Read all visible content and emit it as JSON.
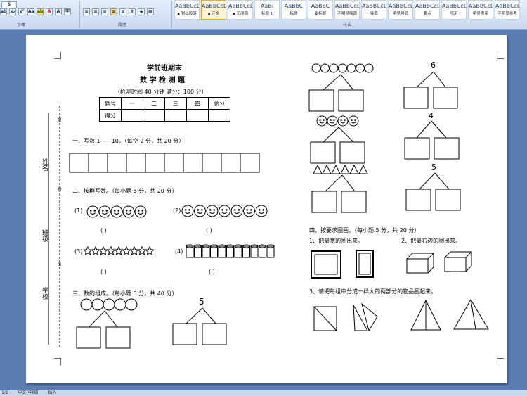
{
  "ribbon": {
    "font_size_value": "5",
    "group_font": "字体",
    "group_paragraph": "段落",
    "group_styles": "样式",
    "styles": [
      {
        "preview": "AaBbCcDd",
        "name": "▪ 列出段落"
      },
      {
        "preview": "AaBbCcDd",
        "name": "▪ 正文"
      },
      {
        "preview": "AaBbCcDd",
        "name": "▪ 无间隔"
      },
      {
        "preview": "AaBl",
        "name": "标题 1"
      },
      {
        "preview": "AaBbC",
        "name": "标题"
      },
      {
        "preview": "AaBbC",
        "name": "副标题"
      },
      {
        "preview": "AaBbCcDd",
        "name": "不明显强调"
      },
      {
        "preview": "AaBbCcDd",
        "name": "强调"
      },
      {
        "preview": "AaBbCcDd",
        "name": "明显强调"
      },
      {
        "preview": "AaBbCcDd",
        "name": "要点"
      },
      {
        "preview": "AaBbCcDd",
        "name": "引用"
      },
      {
        "preview": "AaBbCcDd",
        "name": "明显引用"
      },
      {
        "preview": "AaBbCcDd",
        "name": "不明显参考"
      }
    ]
  },
  "doc": {
    "title1": "学前班期末",
    "title2": "数 学 检 测 题",
    "info": "（检测时间 40 分钟     满分：100 分）",
    "score_header": [
      "题号",
      "一",
      "二",
      "三",
      "四",
      "总分"
    ],
    "score_row_label": "得分",
    "margin_name": "姓名",
    "margin_class": "班级",
    "margin_school": "学校",
    "margin_seal1": "線",
    "margin_seal2": "封",
    "margin_seal3": "密",
    "q1": "一、写数 1——10。（每空 2 分，共 20 分）",
    "q2": "二、按群写数。（每小题 5 分，共 20 分）",
    "q2_items": [
      "(1)",
      "(2)",
      "(3)",
      "(4)"
    ],
    "paren": "(          )",
    "q3": "三、数的组成。（每小题 5 分，共 40 分）",
    "q3_number_5": "5",
    "right_number_6": "6",
    "right_number_4": "4",
    "right_number_5": "5",
    "q4": "四、按要求圈画。（每小题 5 分，共 20 分）",
    "q4_1": "1、把最宽的圈出来。",
    "q4_2": "2、把最右边的圈出来。",
    "q4_3": "3、请把每组中分成一样大的两部分的物品圈起来。"
  },
  "status": {
    "page": "1/1",
    "language": "中文(中国)",
    "mode": "插入"
  }
}
